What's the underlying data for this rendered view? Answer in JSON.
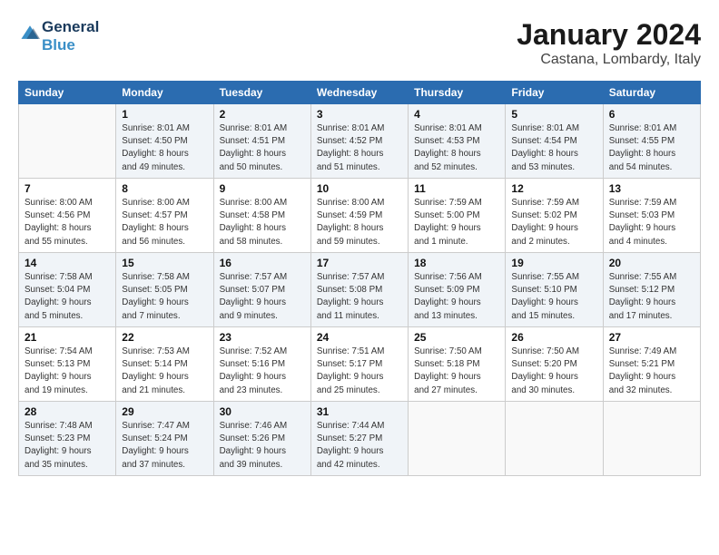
{
  "header": {
    "logo_line1": "General",
    "logo_line2": "Blue",
    "main_title": "January 2024",
    "sub_title": "Castana, Lombardy, Italy"
  },
  "days_of_week": [
    "Sunday",
    "Monday",
    "Tuesday",
    "Wednesday",
    "Thursday",
    "Friday",
    "Saturday"
  ],
  "weeks": [
    [
      {
        "day": "",
        "info": ""
      },
      {
        "day": "1",
        "info": "Sunrise: 8:01 AM\nSunset: 4:50 PM\nDaylight: 8 hours\nand 49 minutes."
      },
      {
        "day": "2",
        "info": "Sunrise: 8:01 AM\nSunset: 4:51 PM\nDaylight: 8 hours\nand 50 minutes."
      },
      {
        "day": "3",
        "info": "Sunrise: 8:01 AM\nSunset: 4:52 PM\nDaylight: 8 hours\nand 51 minutes."
      },
      {
        "day": "4",
        "info": "Sunrise: 8:01 AM\nSunset: 4:53 PM\nDaylight: 8 hours\nand 52 minutes."
      },
      {
        "day": "5",
        "info": "Sunrise: 8:01 AM\nSunset: 4:54 PM\nDaylight: 8 hours\nand 53 minutes."
      },
      {
        "day": "6",
        "info": "Sunrise: 8:01 AM\nSunset: 4:55 PM\nDaylight: 8 hours\nand 54 minutes."
      }
    ],
    [
      {
        "day": "7",
        "info": "Sunrise: 8:00 AM\nSunset: 4:56 PM\nDaylight: 8 hours\nand 55 minutes."
      },
      {
        "day": "8",
        "info": "Sunrise: 8:00 AM\nSunset: 4:57 PM\nDaylight: 8 hours\nand 56 minutes."
      },
      {
        "day": "9",
        "info": "Sunrise: 8:00 AM\nSunset: 4:58 PM\nDaylight: 8 hours\nand 58 minutes."
      },
      {
        "day": "10",
        "info": "Sunrise: 8:00 AM\nSunset: 4:59 PM\nDaylight: 8 hours\nand 59 minutes."
      },
      {
        "day": "11",
        "info": "Sunrise: 7:59 AM\nSunset: 5:00 PM\nDaylight: 9 hours\nand 1 minute."
      },
      {
        "day": "12",
        "info": "Sunrise: 7:59 AM\nSunset: 5:02 PM\nDaylight: 9 hours\nand 2 minutes."
      },
      {
        "day": "13",
        "info": "Sunrise: 7:59 AM\nSunset: 5:03 PM\nDaylight: 9 hours\nand 4 minutes."
      }
    ],
    [
      {
        "day": "14",
        "info": "Sunrise: 7:58 AM\nSunset: 5:04 PM\nDaylight: 9 hours\nand 5 minutes."
      },
      {
        "day": "15",
        "info": "Sunrise: 7:58 AM\nSunset: 5:05 PM\nDaylight: 9 hours\nand 7 minutes."
      },
      {
        "day": "16",
        "info": "Sunrise: 7:57 AM\nSunset: 5:07 PM\nDaylight: 9 hours\nand 9 minutes."
      },
      {
        "day": "17",
        "info": "Sunrise: 7:57 AM\nSunset: 5:08 PM\nDaylight: 9 hours\nand 11 minutes."
      },
      {
        "day": "18",
        "info": "Sunrise: 7:56 AM\nSunset: 5:09 PM\nDaylight: 9 hours\nand 13 minutes."
      },
      {
        "day": "19",
        "info": "Sunrise: 7:55 AM\nSunset: 5:10 PM\nDaylight: 9 hours\nand 15 minutes."
      },
      {
        "day": "20",
        "info": "Sunrise: 7:55 AM\nSunset: 5:12 PM\nDaylight: 9 hours\nand 17 minutes."
      }
    ],
    [
      {
        "day": "21",
        "info": "Sunrise: 7:54 AM\nSunset: 5:13 PM\nDaylight: 9 hours\nand 19 minutes."
      },
      {
        "day": "22",
        "info": "Sunrise: 7:53 AM\nSunset: 5:14 PM\nDaylight: 9 hours\nand 21 minutes."
      },
      {
        "day": "23",
        "info": "Sunrise: 7:52 AM\nSunset: 5:16 PM\nDaylight: 9 hours\nand 23 minutes."
      },
      {
        "day": "24",
        "info": "Sunrise: 7:51 AM\nSunset: 5:17 PM\nDaylight: 9 hours\nand 25 minutes."
      },
      {
        "day": "25",
        "info": "Sunrise: 7:50 AM\nSunset: 5:18 PM\nDaylight: 9 hours\nand 27 minutes."
      },
      {
        "day": "26",
        "info": "Sunrise: 7:50 AM\nSunset: 5:20 PM\nDaylight: 9 hours\nand 30 minutes."
      },
      {
        "day": "27",
        "info": "Sunrise: 7:49 AM\nSunset: 5:21 PM\nDaylight: 9 hours\nand 32 minutes."
      }
    ],
    [
      {
        "day": "28",
        "info": "Sunrise: 7:48 AM\nSunset: 5:23 PM\nDaylight: 9 hours\nand 35 minutes."
      },
      {
        "day": "29",
        "info": "Sunrise: 7:47 AM\nSunset: 5:24 PM\nDaylight: 9 hours\nand 37 minutes."
      },
      {
        "day": "30",
        "info": "Sunrise: 7:46 AM\nSunset: 5:26 PM\nDaylight: 9 hours\nand 39 minutes."
      },
      {
        "day": "31",
        "info": "Sunrise: 7:44 AM\nSunset: 5:27 PM\nDaylight: 9 hours\nand 42 minutes."
      },
      {
        "day": "",
        "info": ""
      },
      {
        "day": "",
        "info": ""
      },
      {
        "day": "",
        "info": ""
      }
    ]
  ]
}
